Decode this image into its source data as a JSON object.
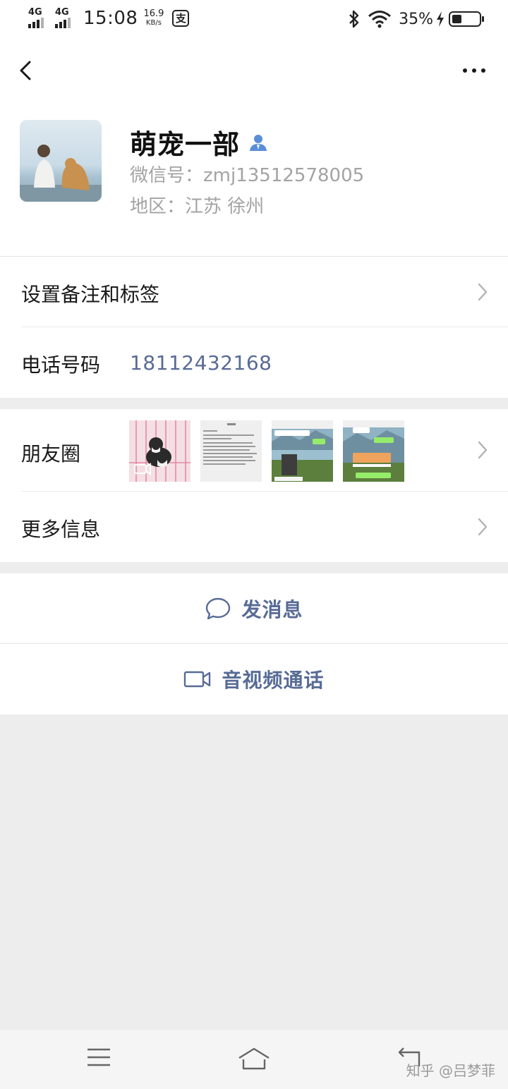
{
  "status_bar": {
    "net1": "4G",
    "net2": "4G",
    "time": "15:08",
    "speed_value": "16.9",
    "speed_unit": "KB/s",
    "alipay_glyph": "支",
    "battery_pct": "35%",
    "battery_level": 0.35,
    "icons": [
      "bluetooth-icon",
      "wifi-icon",
      "charging-icon",
      "battery-icon"
    ]
  },
  "nav": {
    "back_icon": "chevron-left-icon",
    "more_icon": "more-dots-icon"
  },
  "profile": {
    "name": "萌宠一部",
    "wechat_id": "微信号：zmj13512578005",
    "region": "地区：江苏  徐州",
    "badge_icon": "person-icon"
  },
  "cells": {
    "remark_label": "设置备注和标签",
    "phone_label": "电话号码",
    "phone_value": "18112432168",
    "moments_label": "朋友圈",
    "more_info_label": "更多信息"
  },
  "actions": {
    "message_label": "发消息",
    "call_label": "音视频通话"
  },
  "bottom_nav": {
    "icons": [
      "menu-icon",
      "home-icon",
      "return-icon"
    ],
    "watermark": "知乎 @吕梦菲"
  },
  "colors": {
    "link_blue": "#576b95",
    "secondary_text": "#a3a3a3",
    "page_bg": "#ededed",
    "badge_blue": "#5a8fd8"
  }
}
